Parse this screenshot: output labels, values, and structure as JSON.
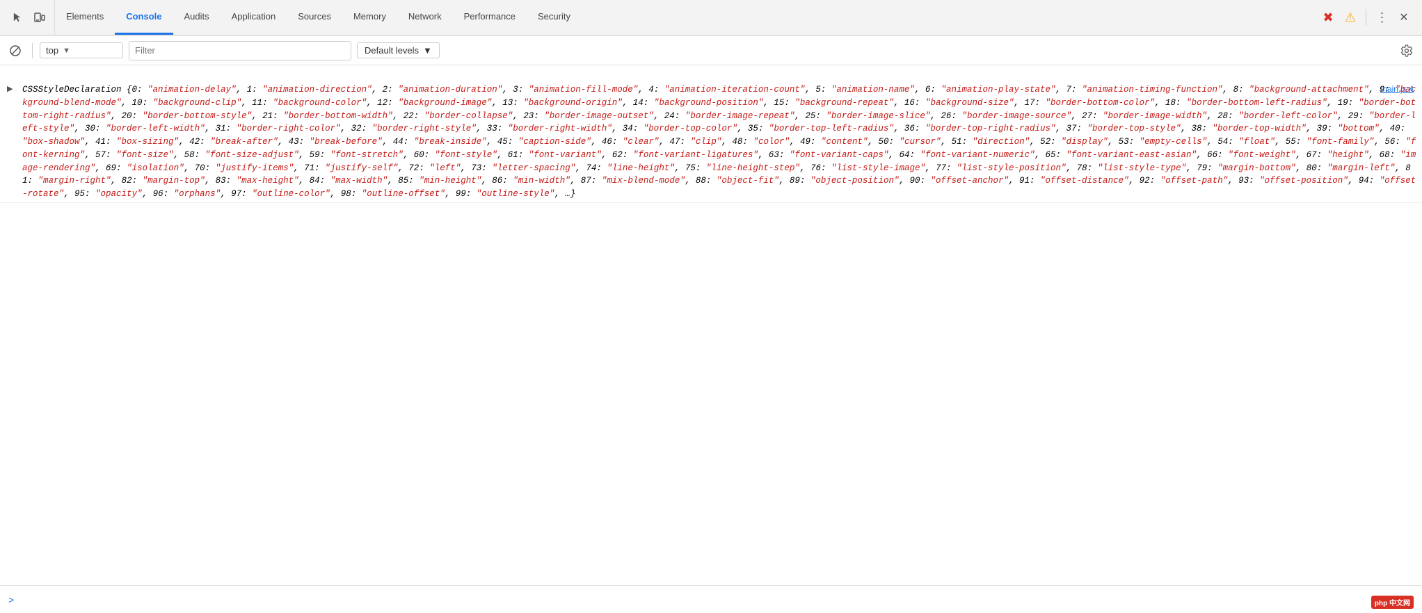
{
  "nav": {
    "tabs": [
      {
        "id": "elements",
        "label": "Elements",
        "active": false
      },
      {
        "id": "console",
        "label": "Console",
        "active": true
      },
      {
        "id": "audits",
        "label": "Audits",
        "active": false
      },
      {
        "id": "application",
        "label": "Application",
        "active": false
      },
      {
        "id": "sources",
        "label": "Sources",
        "active": false
      },
      {
        "id": "memory",
        "label": "Memory",
        "active": false
      },
      {
        "id": "network",
        "label": "Network",
        "active": false
      },
      {
        "id": "performance",
        "label": "Performance",
        "active": false
      },
      {
        "id": "security",
        "label": "Security",
        "active": false
      }
    ]
  },
  "toolbar": {
    "context": "top",
    "filter_placeholder": "Filter",
    "levels_label": "Default levels",
    "ban_icon": "🚫",
    "dropdown_arrow": "▼"
  },
  "console": {
    "file_link": "main.js:4",
    "message_text": "CSSStyleDeclaration {0: \"animation-delay\", 1: \"animation-direction\", 2: \"animation-duration\", 3: \"animation-fill-mode\", 4: \"animation-iteration-count\", 5: \"animation-name\", 6: \"animation-play-state\", 7: \"animation-timing-function\", 8: \"background-attachment\", 9: \"background-blend-mode\", 10: \"background-clip\", 11: \"background-color\", 12: \"background-image\", 13: \"background-origin\", 14: \"background-position\", 15: \"background-repeat\", 16: \"background-size\", 17: \"border-bottom-color\", 18: \"border-bottom-left-radius\", 19: \"border-bottom-right-radius\", 20: \"border-bottom-style\", 21: \"border-bottom-width\", 22: \"border-collapse\", 23: \"border-image-outset\", 24: \"border-image-repeat\", 25: \"border-image-slice\", 26: \"border-image-source\", 27: \"border-image-width\", 28: \"border-left-color\", 29: \"border-left-style\", 30: \"border-left-width\", 31: \"border-right-color\", 32: \"border-right-style\", 33: \"border-right-width\", 34: \"border-top-color\", 35: \"border-top-left-radius\", 36: \"border-top-right-radius\", 37: \"border-top-style\", 38: \"border-top-width\", 39: \"bottom\", 40: \"box-shadow\", 41: \"box-sizing\", 42: \"break-after\", 43: \"break-before\", 44: \"break-inside\", 45: \"caption-side\", 46: \"clear\", 47: \"clip\", 48: \"color\", 49: \"content\", 50: \"cursor\", 51: \"direction\", 52: \"display\", 53: \"empty-cells\", 54: \"float\", 55: \"font-family\", 56: \"font-kerning\", 57: \"font-size\", 58: \"font-size-adjust\", 59: \"font-stretch\", 60: \"font-style\", 61: \"font-variant\", 62: \"font-variant-ligatures\", 63: \"font-variant-caps\", 64: \"font-variant-numeric\", 65: \"font-variant-east-asian\", 66: \"font-weight\", 67: \"height\", 68: \"image-rendering\", 69: \"isolation\", 70: \"justify-items\", 71: \"justify-self\", 72: \"left\", 73: \"letter-spacing\", 74: \"line-height\", 75: \"line-height-step\", 76: \"list-style-image\", 77: \"list-style-position\", 78: \"list-style-type\", 79: \"margin-bottom\", 80: \"margin-left\", 81: \"margin-right\", 82: \"margin-top\", 83: \"max-height\", 84: \"max-width\", 85: \"min-height\", 86: \"min-width\", 87: \"mix-blend-mode\", 88: \"object-fit\", 89: \"object-position\", 90: \"offset-anchor\", 91: \"offset-distance\", 92: \"offset-path\", 93: \"offset-position\", 94: \"offset-rotate\", 95: \"opacity\", 96: \"orphans\", 97: \"outline-color\", 98: \"outline-offset\", 99: \"outline-style\", …}"
  },
  "bottom_bar": {
    "prompt": ">",
    "logo_text": "php 中文网"
  }
}
